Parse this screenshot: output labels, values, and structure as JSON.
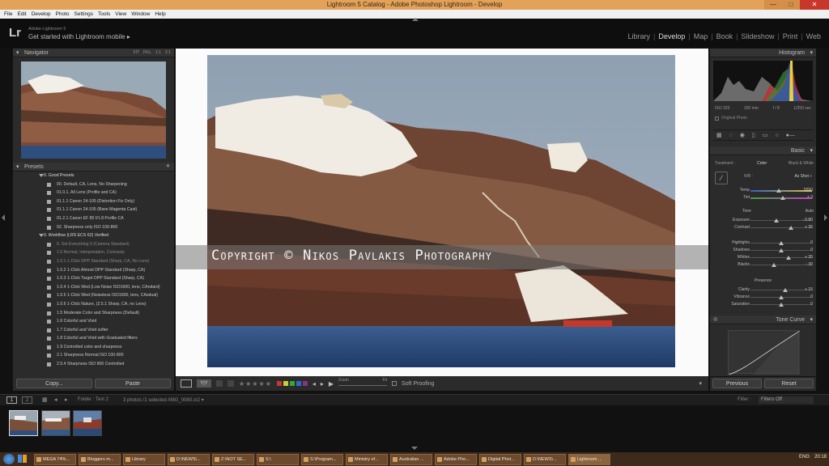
{
  "window": {
    "title": "Lightroom 5 Catalog - Adobe Photoshop Lightroom - Develop"
  },
  "menu": [
    "File",
    "Edit",
    "Develop",
    "Photo",
    "Settings",
    "Tools",
    "View",
    "Window",
    "Help"
  ],
  "identity": {
    "logo": "Lr",
    "product": "Adobe Lightroom 5",
    "prompt": "Get started with Lightroom mobile ▸"
  },
  "modules": [
    {
      "label": "Library",
      "active": false
    },
    {
      "label": "Develop",
      "active": true
    },
    {
      "label": "Map",
      "active": false
    },
    {
      "label": "Book",
      "active": false
    },
    {
      "label": "Slideshow",
      "active": false
    },
    {
      "label": "Print",
      "active": false
    },
    {
      "label": "Web",
      "active": false
    }
  ],
  "navigator": {
    "title": "Navigator",
    "zoom_options": [
      "FIT",
      "FILL",
      "1:1",
      "2:1"
    ]
  },
  "presets": {
    "title": "Presets",
    "items": [
      {
        "label": "0. Good Presets",
        "folder": true
      },
      {
        "label": "00. Default, CA, Lens, No Sharpening",
        "folder": false
      },
      {
        "label": "01.0.1. All Lens (Profile and CA)",
        "folder": false
      },
      {
        "label": "01.1.1 Canon 24-105 (Distortion Fix Only)",
        "folder": false
      },
      {
        "label": "01.1.1 Canon 24-105 (Base Magenta Cast)",
        "folder": false
      },
      {
        "label": "01.2.1 Canon EF 85 f/1.8 Profile CA",
        "folder": false
      },
      {
        "label": "02. Sharpness only ISO 100-800",
        "folder": false
      },
      {
        "label": "0. Workflow (LRS ECS 62) Verified",
        "folder": true
      },
      {
        "label": "0. Set Everything 0 (Camera Standard)",
        "folder": false
      },
      {
        "label": "1.0 Normal, Interpretation, Contrasty",
        "folder": false
      },
      {
        "label": "1.0.1 1-Click DPP Standard (Sharp, CA, No Lens)",
        "folder": false
      },
      {
        "label": "1.0.2 1-Click Almost DPP Standard (Sharp, CA)",
        "folder": false
      },
      {
        "label": "1.0.3 1-Click Target DPP Standard (Sharp, CA)",
        "folder": false
      },
      {
        "label": "1.0.4 1-Click Wed (Low Noise ISO1600, lens, CAndard)",
        "folder": false
      },
      {
        "label": "1.0.5 1-Click Wed (Noiseless ISO1600, lens, CAsdual)",
        "folder": false
      },
      {
        "label": "1.0.6 1-Click Nature, (2.5.1 Sharp, CA, no Lens)",
        "folder": false
      },
      {
        "label": "1.5 Moderate Color and Sharpness (Default)",
        "folder": false
      },
      {
        "label": "1.6 Colorful and Vivid",
        "folder": false
      },
      {
        "label": "1.7 Colorful and Vivid softer",
        "folder": false
      },
      {
        "label": "1.8 Colorful and Vivid with Graduated filters",
        "folder": false
      },
      {
        "label": "1.9 Controlled color and sharpness",
        "folder": false
      },
      {
        "label": "2.1 Sharpness Normal ISO 100-800",
        "folder": false
      },
      {
        "label": "2.5.4 Sharpness ISO 800 Controlled",
        "folder": false
      }
    ]
  },
  "left_buttons": {
    "copy": "Copy...",
    "paste": "Paste"
  },
  "watermark": "Copyright © Nikos Pavlakis Photography",
  "toolbar": {
    "zoom_label": "Zoom",
    "zoom_value": "Fit",
    "soft_proofing": "Soft Proofing",
    "stars": "★★★★★"
  },
  "histogram": {
    "title": "Histogram",
    "iso": "ISO 320",
    "focal": "100 mm",
    "aperture": "f / 8",
    "shutter": "1/250 sec",
    "original_photo": "Original Photo"
  },
  "basic": {
    "title": "Basic",
    "treatment_label": "Treatment :",
    "treatment_color": "Color",
    "treatment_bw": "Black & White",
    "wb_label": "WB :",
    "wb_value": "As Shot ÷",
    "tone_label": "Tone",
    "tone_auto": "Auto",
    "presence_label": "Presence",
    "sliders": [
      {
        "label": "Temp",
        "value": "5550",
        "pos": 0.46,
        "group": "wb"
      },
      {
        "label": "Tint",
        "value": "+ 3",
        "pos": 0.52,
        "group": "wb"
      },
      {
        "label": "Exposure",
        "value": "- 0.80",
        "pos": 0.42,
        "group": "tone"
      },
      {
        "label": "Contrast",
        "value": "+ 35",
        "pos": 0.66,
        "group": "tone"
      },
      {
        "label": "Highlights",
        "value": "0",
        "pos": 0.5,
        "group": "tone2"
      },
      {
        "label": "Shadows",
        "value": "0",
        "pos": 0.5,
        "group": "tone2"
      },
      {
        "label": "Whites",
        "value": "+ 35",
        "pos": 0.62,
        "group": "tone2"
      },
      {
        "label": "Blacks",
        "value": "- 30",
        "pos": 0.38,
        "group": "tone2"
      },
      {
        "label": "Clarity",
        "value": "+ 15",
        "pos": 0.57,
        "group": "presence"
      },
      {
        "label": "Vibrance",
        "value": "0",
        "pos": 0.5,
        "group": "presence"
      },
      {
        "label": "Saturation",
        "value": "0",
        "pos": 0.5,
        "group": "presence"
      }
    ]
  },
  "tone_curve": {
    "title": "Tone Curve"
  },
  "right_buttons": {
    "previous": "Previous",
    "reset": "Reset"
  },
  "filmstrip": {
    "folder": "Folder : Test 2",
    "count": "3 photos /1 selected /IMG_0080.cr2 ▾",
    "filter_label": "Filter :",
    "filter_value": "Filters Off",
    "page_left": "1",
    "page_right": "2"
  },
  "taskbar": {
    "items": [
      "MEGA 74%...",
      "Bloggers m...",
      "Library",
      "D:\\NEWS\\...",
      "Z:\\NOT SE...",
      "S:\\",
      "S:\\Program...",
      "Ministry of...",
      "Australian ...",
      "Adobe Pho...",
      "Digital Phot...",
      "D:\\NEWS\\...",
      "Lightroom ..."
    ],
    "lang": "ENG",
    "time": "20:18"
  }
}
